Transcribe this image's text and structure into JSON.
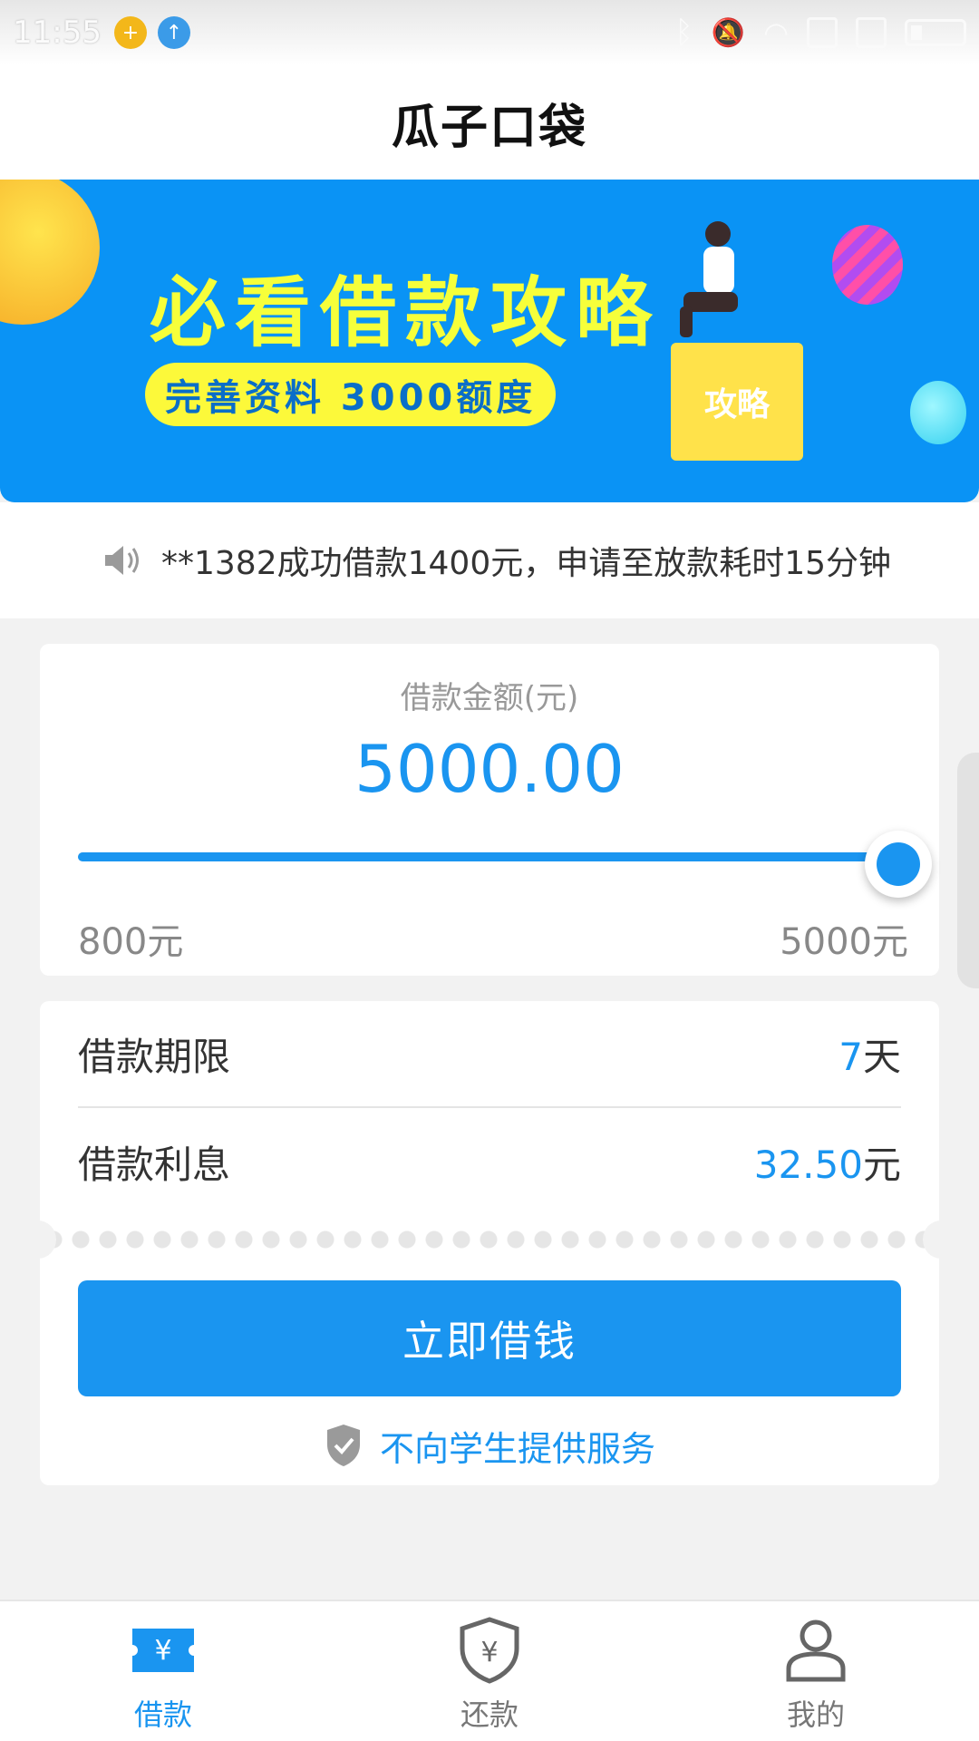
{
  "status_bar": {
    "time": "11:55",
    "icons": [
      "app-360-icon",
      "upload-icon",
      "bluetooth-icon",
      "mute-icon",
      "wifi-icon",
      "sim1-icon",
      "sim2-icon",
      "battery-icon"
    ]
  },
  "header": {
    "title": "瓜子口袋"
  },
  "banner": {
    "title": "必看借款攻略",
    "pill": "完善资料 3000额度",
    "card_label": "攻略"
  },
  "notice": {
    "icon": "speaker-icon",
    "text": "**1382成功借款1400元，申请至放款耗时15分钟"
  },
  "loan": {
    "amount_label": "借款金额(元)",
    "amount_value": "5000.00",
    "slider_fraction": 1.0,
    "min_label": "800元",
    "max_label": "5000元"
  },
  "details": {
    "term_label": "借款期限",
    "term_value": "7",
    "term_unit": "天",
    "interest_label": "借款利息",
    "interest_value": "32.50",
    "interest_unit": "元"
  },
  "action": {
    "borrow_button": "立即借钱",
    "student_note": "不向学生提供服务"
  },
  "bottom_nav": [
    {
      "label": "借款",
      "icon": "loan-ticket-icon",
      "active": true
    },
    {
      "label": "还款",
      "icon": "shield-yen-icon",
      "active": false
    },
    {
      "label": "我的",
      "icon": "user-icon",
      "active": false
    }
  ],
  "colors": {
    "accent": "#1a95f0",
    "banner_bg": "#0a93f5",
    "banner_title": "#f6ff3a",
    "background": "#f2f2f2"
  }
}
